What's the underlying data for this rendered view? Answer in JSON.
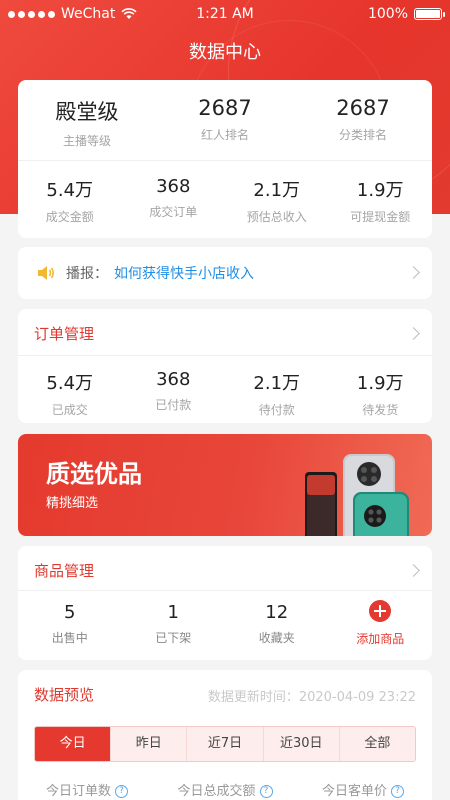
{
  "status_bar": {
    "carrier": "WeChat",
    "time": "1:21 AM",
    "battery": "100%"
  },
  "header": {
    "title": "数据中心"
  },
  "overview": {
    "top": [
      {
        "value": "殿堂级",
        "label": "主播等级"
      },
      {
        "value": "2687",
        "label": "红人排名"
      },
      {
        "value": "2687",
        "label": "分类排名"
      }
    ],
    "bottom": [
      {
        "value": "5.4万",
        "label": "成交金额"
      },
      {
        "value": "368",
        "label": "成交订单"
      },
      {
        "value": "2.1万",
        "label": "预估总收入"
      },
      {
        "value": "1.9万",
        "label": "可提现金额"
      }
    ]
  },
  "broadcast": {
    "prefix": "播报：",
    "link": "如何获得快手小店收入"
  },
  "orders": {
    "title": "订单管理",
    "stats": [
      {
        "value": "5.4万",
        "label": "已成交"
      },
      {
        "value": "368",
        "label": "已付款"
      },
      {
        "value": "2.1万",
        "label": "待付款"
      },
      {
        "value": "1.9万",
        "label": "待发货"
      }
    ]
  },
  "promo": {
    "title": "质选优品",
    "subtitle": "精挑细选"
  },
  "products": {
    "title": "商品管理",
    "stats": [
      {
        "value": "5",
        "label": "出售中"
      },
      {
        "value": "1",
        "label": "已下架"
      },
      {
        "value": "12",
        "label": "收藏夹"
      }
    ],
    "add_label": "添加商品"
  },
  "data_preview": {
    "title": "数据预览",
    "updated": "数据更新时间：2020-04-09 23:22",
    "tabs": [
      "今日",
      "昨日",
      "近7日",
      "近30日",
      "全部"
    ],
    "active_tab": "今日",
    "metrics": [
      "今日订单数",
      "今日总成交额",
      "今日客单价"
    ]
  },
  "colors": {
    "accent": "#e5392f",
    "link": "#1f8ee6"
  }
}
